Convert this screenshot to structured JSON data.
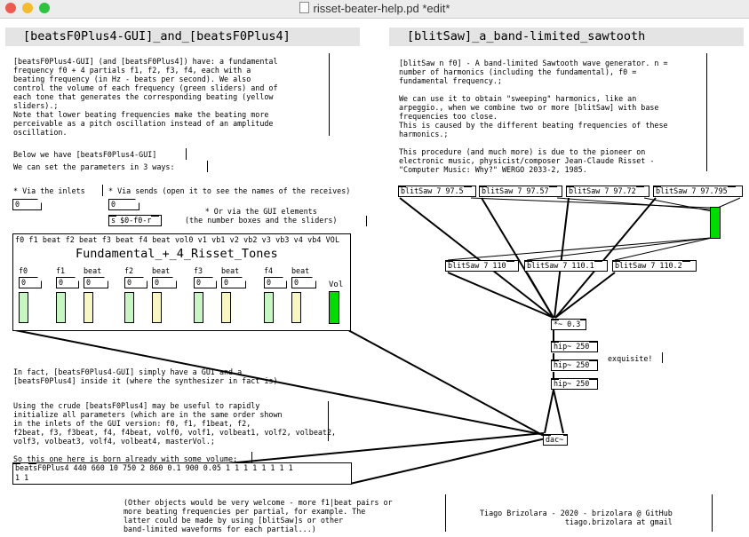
{
  "window": {
    "title": "risset-beater-help.pd *edit*"
  },
  "left": {
    "header": "[beatsF0Plus4-GUI]_and_[beatsF0Plus4]",
    "intro": "[beatsF0Plus4-GUI] (and [beatsF0Plus4]) have: a fundamental\nfrequency f0 + 4 partials f1, f2, f3, f4, each with a\nbeating frequency (in Hz - beats per second). We also\ncontrol the volume of each frequency (green sliders) and of\neach tone that generates the corresponding beating (yellow\nsliders).;\nNote that lower beating frequencies make the beating more\nperceivable as a pitch oscillation instead of an amplitude\noscillation.",
    "below_we_have": "Below we have [beatsF0Plus4-GUI]",
    "set_params": "We can set the parameters in 3 ways:",
    "via_inlets": "* Via the inlets",
    "via_sends": "* Via sends (open it to see the names of the receives)",
    "via_gui": "* Or via the GUI elements\n(the number boxes and the sliders)",
    "inlet_number": "0",
    "send_number": "0",
    "send_object": "s $0-f0-r",
    "gui_inlets": "f0 f1 beat f2 beat f3 beat f4 beat vol0 v1 vb1 v2 vb2 v3 vb3 v4 vb4 VOL",
    "gui_title": "Fundamental_+_4_Risset_Tones",
    "controls": [
      {
        "label": "f0",
        "value": "0",
        "color": "green"
      },
      {
        "label": "f1",
        "value": "0",
        "color": "green"
      },
      {
        "label": "beat",
        "value": "0",
        "color": "yellow"
      },
      {
        "label": "f2",
        "value": "0",
        "color": "green"
      },
      {
        "label": "beat",
        "value": "0",
        "color": "yellow"
      },
      {
        "label": "f3",
        "value": "0",
        "color": "green"
      },
      {
        "label": "beat",
        "value": "0",
        "color": "yellow"
      },
      {
        "label": "f4",
        "value": "0",
        "color": "green"
      },
      {
        "label": "beat",
        "value": "0",
        "color": "yellow"
      }
    ],
    "vol_label": "Vol",
    "in_fact": "In fact, [beatsF0Plus4-GUI] simply have a GUI and a\n[beatsF0Plus4] inside it (where the synthesizer in fact is).",
    "crude": "Using the crude [beatsF0Plus4] may be useful to rapidly\ninitialize all parameters (which are in the same order shown\nin the inlets of the GUI version: f0, f1, f1beat, f2,\nf2beat, f3, f3beat, f4, f4beat, volf0, volf1, volbeat1, volf2, volbeat2,\nvolf3, volbeat3, volf4, volbeat4, masterVol.;",
    "born": "So this one here is born already with some volume:",
    "beats_object": "beatsF0Plus4 440 660 10 750 2 860 0.1 900 0.05 1 1 1 1 1 1 1 1\n1 1",
    "other_objects": "(Other objects would be very welcome - more f1|beat pairs or\nmore beating frequencies per partial, for example. The\nlatter could be made by using [blitSaw]s or other\nband-limited waveforms for each partial...)"
  },
  "right": {
    "header": "[blitSaw]_a_band-limited_sawtooth",
    "desc": "[blitSaw n f0] - A band-limited Sawtooth wave generator. n =\nnumber of harmonics (including the fundamental), f0 =\nfundamental frequency.;\n\nWe can use it to obtain \"sweeping\" harmonics, like an\narpeggio., when we combine two or more [blitSaw] with base\nfrequencies too close.\nThis is caused by the different beating frequencies of these\nharmonics.;\n\nThis procedure (and much more) is due to the pioneer on\nelectronic music, physicist/composer Jean-Claude Risset -\n\"Computer Music: Why?\" WERGO 2033-2, 1985.",
    "blit_top": [
      "blitSaw 7 97.5",
      "blitSaw 7 97.57",
      "blitSaw 7 97.72",
      "blitSaw 7 97.795"
    ],
    "blit_mid": [
      "blitSaw 7 110",
      "blitSaw 7 110.1",
      "blitSaw 7 110.2"
    ],
    "mult": "*~ 0.3",
    "hips": [
      "hip~ 250",
      "hip~ 250",
      "hip~ 250"
    ],
    "exquisite": "exquisite!",
    "dac": "dac~",
    "credit": "Tiago Brizolara - 2020 - brizolara @ GitHub\ntiago.brizolara at gmail"
  },
  "colors": {
    "green": "#c8f5c4",
    "yellow": "#f8f6c2",
    "vol": "#00dc00",
    "blit_slider": "#00dc00",
    "header_bg": "#e4e4e4"
  }
}
